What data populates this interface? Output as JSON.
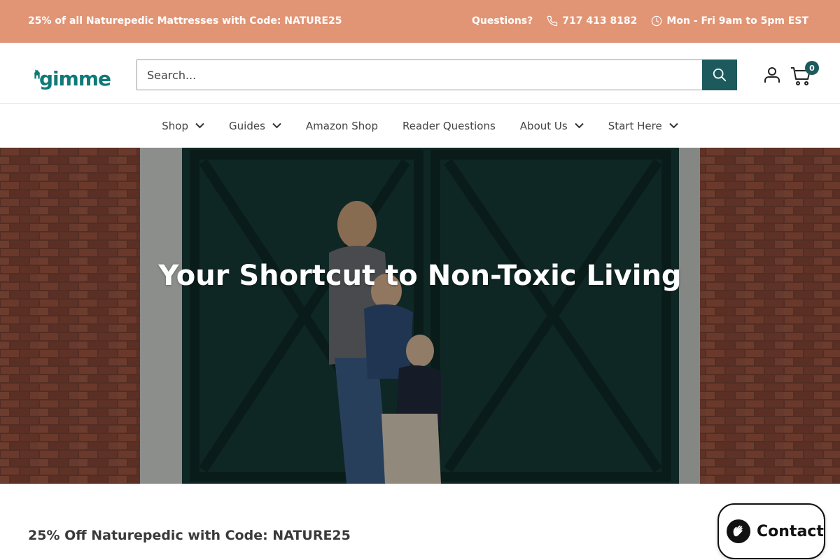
{
  "announcement": {
    "promo": "25% of all Naturepedic Mattresses with Code: NATURE25",
    "questions_label": "Questions?",
    "phone": "717 413 8182",
    "hours": "Mon - Fri 9am to 5pm EST"
  },
  "header": {
    "logo_text": "gimme",
    "search_placeholder": "Search...",
    "cart_count": "0"
  },
  "nav": {
    "items": [
      {
        "label": "Shop",
        "has_dropdown": true
      },
      {
        "label": "Guides",
        "has_dropdown": true
      },
      {
        "label": "Amazon Shop",
        "has_dropdown": false
      },
      {
        "label": "Reader Questions",
        "has_dropdown": false
      },
      {
        "label": "About Us",
        "has_dropdown": true
      },
      {
        "label": "Start Here",
        "has_dropdown": true
      }
    ]
  },
  "hero": {
    "title": "Your Shortcut to Non-Toxic Living"
  },
  "main": {
    "promo_heading": "25% Off Naturepedic with Code: NATURE25"
  },
  "chat": {
    "label": "Contact"
  },
  "colors": {
    "announcement_bg": "#e19575",
    "brand_teal": "#0f7a78",
    "button_dark_teal": "#1c5a5e",
    "hero_door_green": "#173a35"
  },
  "icons": [
    "phone-icon",
    "clock-icon",
    "house-logo-icon",
    "search-icon",
    "user-icon",
    "cart-icon",
    "chevron-down-icon",
    "chat-wave-icon"
  ]
}
